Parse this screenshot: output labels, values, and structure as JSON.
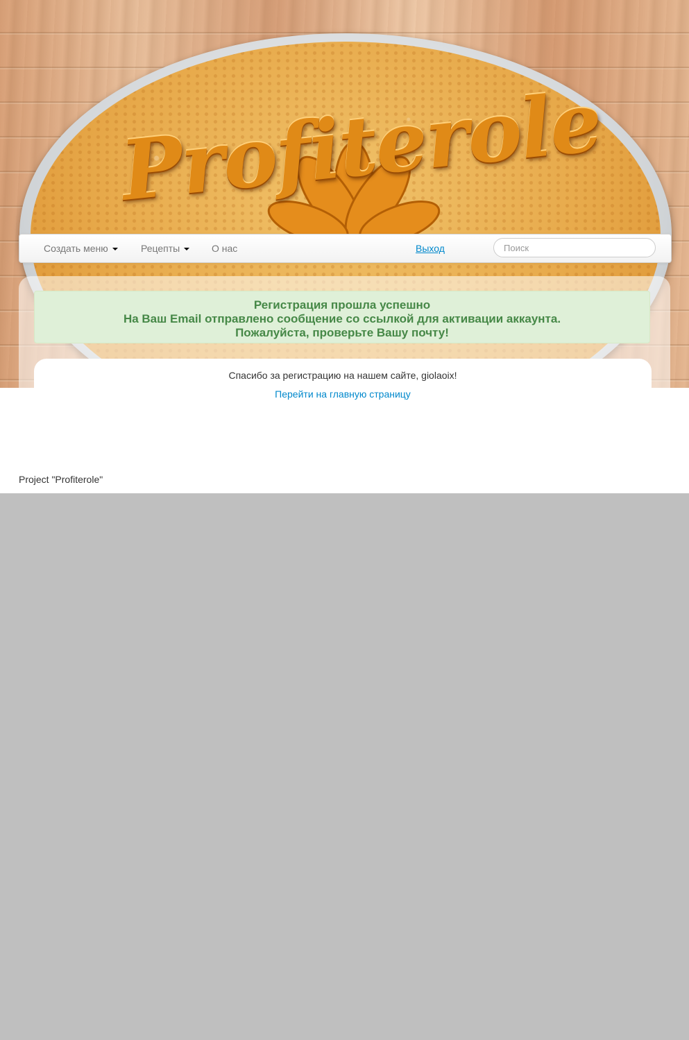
{
  "header": {
    "logo_text": "Profiterole"
  },
  "navbar": {
    "items": [
      {
        "label": "Создать меню",
        "dropdown": true
      },
      {
        "label": "Рецепты",
        "dropdown": true
      },
      {
        "label": "О нас",
        "dropdown": false
      }
    ],
    "logout_label": "Выход",
    "search_placeholder": "Поиск"
  },
  "alert": {
    "line1": "Регистрация прошла успешно",
    "line2": "На Ваш Email отправлено сообщение со ссылкой для активации аккаунта.",
    "line3": "Пожалуйста, проверьте Вашу почту!"
  },
  "main": {
    "thanks_text": "Спасибо за регистрацию на нашем сайте, giolaoix!",
    "home_link": "Перейти на главную страницу"
  },
  "footer": {
    "text": "Project \"Profiterole\""
  },
  "colors": {
    "alert_bg": "#dff0d8",
    "alert_text": "#468847",
    "link": "#0088cc",
    "below_page": "#bfbfbf"
  }
}
